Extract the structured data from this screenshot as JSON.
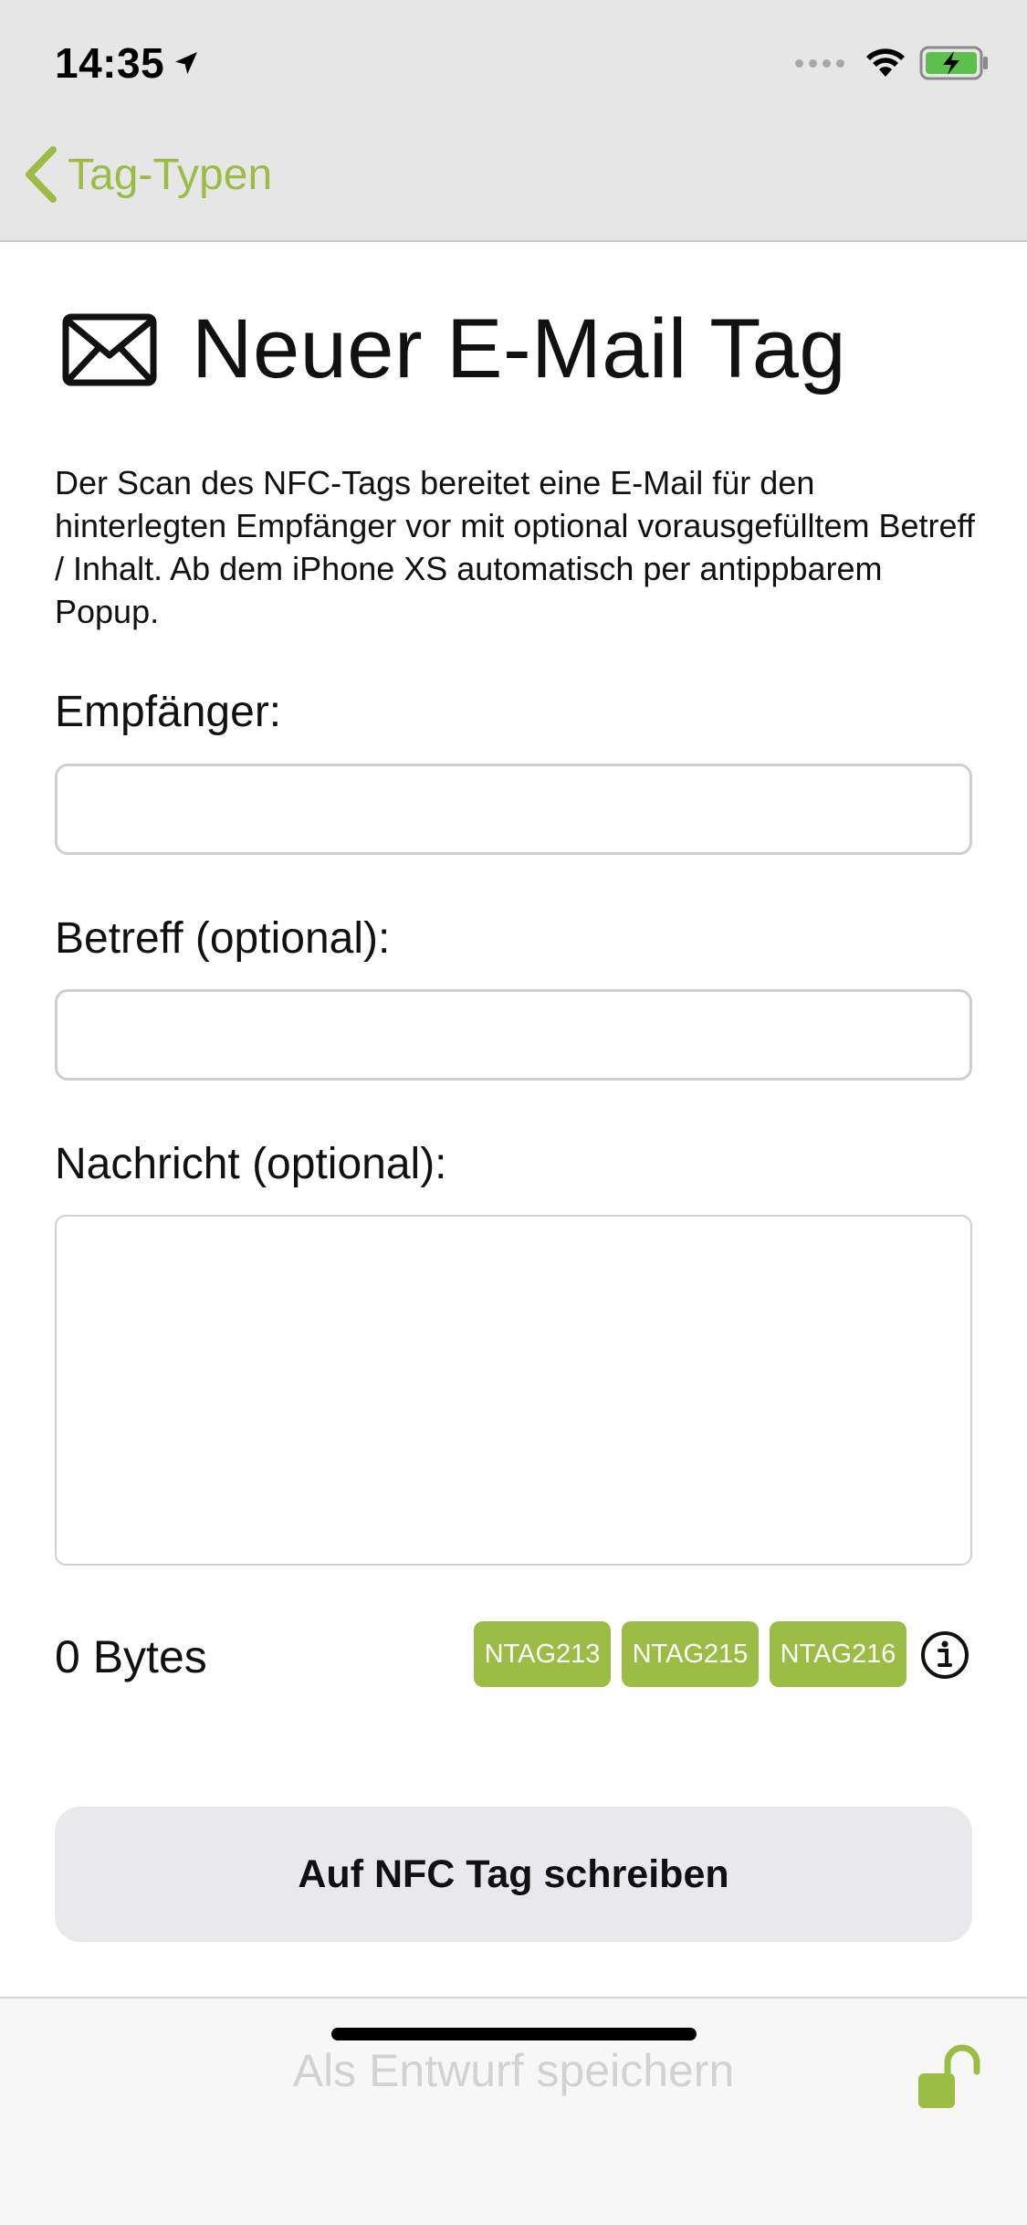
{
  "status_bar": {
    "time": "14:35",
    "icons": [
      "location-arrow-icon",
      "signal-dots-icon",
      "wifi-icon",
      "battery-charging-icon"
    ]
  },
  "nav": {
    "back_label": "Tag-Typen",
    "accent_color": "#9bbd45"
  },
  "page": {
    "title": "Neuer E-Mail Tag",
    "title_icon": "envelope-icon",
    "description": "Der Scan des NFC-Tags bereitet eine E-Mail für den hinterlegten Empfänger vor mit optional vorausgefülltem Betreff / Inhalt. Ab dem iPhone XS automatisch per antippbarem Popup."
  },
  "form": {
    "recipient": {
      "label": "Empfänger:",
      "value": ""
    },
    "subject": {
      "label": "Betreff (optional):",
      "value": ""
    },
    "message": {
      "label": "Nachricht (optional):",
      "value": ""
    }
  },
  "info_row": {
    "bytes_label": "0 Bytes",
    "chips": [
      "NTAG213",
      "NTAG215",
      "NTAG216"
    ]
  },
  "actions": {
    "write_label": "Auf NFC Tag schreiben",
    "draft_label": "Als Entwurf speichern"
  }
}
